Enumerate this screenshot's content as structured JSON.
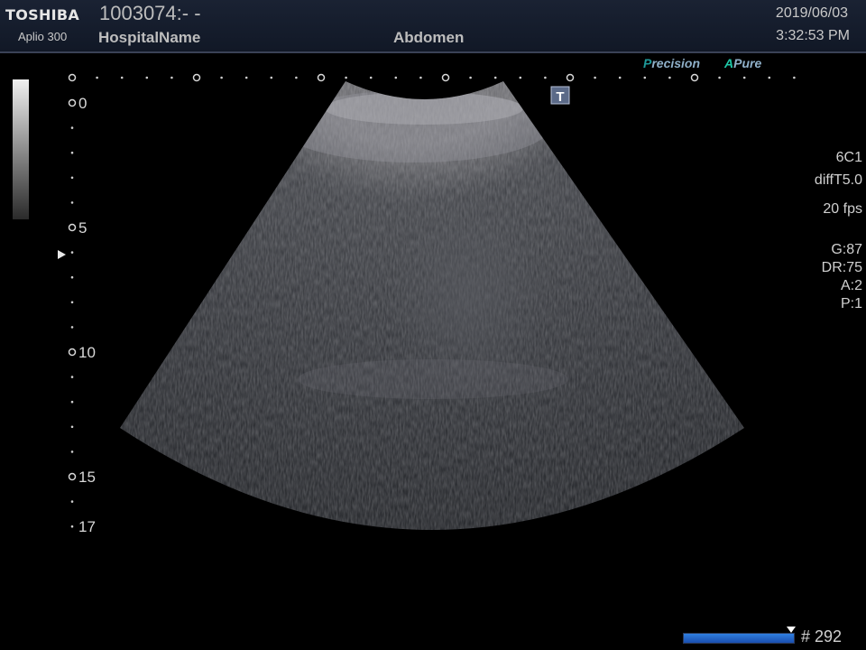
{
  "header": {
    "brand": "TOSHIBA",
    "model": "Aplio 300",
    "patient_id": "1003074:- -",
    "hospital": "HospitalName",
    "exam": "Abdomen",
    "date": "2019/06/03",
    "time": "3:32:53 PM"
  },
  "badges": {
    "precision_mark": "P",
    "precision_rest": "recision",
    "apure_mark": "A",
    "apure_rest": "Pure"
  },
  "focus_marker_label": "T",
  "depth_scale": {
    "labels": [
      "0",
      "5",
      "10",
      "15",
      "17"
    ],
    "focus_depth_cm": 6,
    "max_depth_cm": 17
  },
  "params": {
    "probe": "6C1",
    "preset": "diffT5.0",
    "fps": "20 fps",
    "gain": "G:87",
    "dr": "DR:75",
    "a": "A:2",
    "p": "P:1"
  },
  "cine": {
    "frame_label": "# 292",
    "position_fraction": 0.95
  },
  "colors": {
    "header_bg": "#141c2c",
    "accent_teal": "#1e9a9a",
    "cine_bar": "#2f7fe0"
  }
}
